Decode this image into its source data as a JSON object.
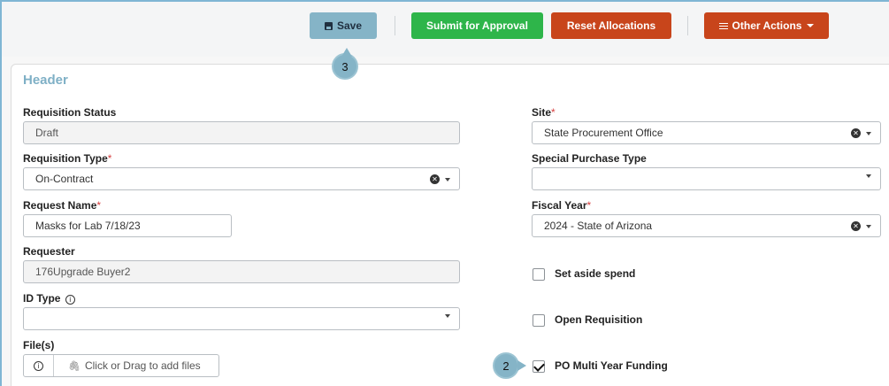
{
  "toolbar": {
    "save_label": "Save",
    "submit_label": "Submit for Approval",
    "reset_label": "Reset Allocations",
    "other_label": "Other Actions"
  },
  "callouts": {
    "step3": "3",
    "step2": "2"
  },
  "header": {
    "title": "Header"
  },
  "left": {
    "requisition_status": {
      "label": "Requisition Status",
      "value": "Draft"
    },
    "requisition_type": {
      "label": "Requisition Type",
      "required": "*",
      "value": "On-Contract"
    },
    "request_name": {
      "label": "Request Name",
      "required": "*",
      "value": "Masks for Lab 7/18/23"
    },
    "requester": {
      "label": "Requester",
      "value": "176Upgrade Buyer2"
    },
    "id_type": {
      "label": "ID Type",
      "value": ""
    },
    "files": {
      "label": "File(s)",
      "placeholder": "Click or Drag to add files"
    }
  },
  "right": {
    "site": {
      "label": "Site",
      "required": "*",
      "value": "State Procurement Office"
    },
    "special_purchase_type": {
      "label": "Special Purchase Type",
      "value": ""
    },
    "fiscal_year": {
      "label": "Fiscal Year",
      "required": "*",
      "value": "2024 - State of Arizona"
    },
    "set_aside_spend": {
      "label": "Set aside spend",
      "checked": false
    },
    "open_requisition": {
      "label": "Open Requisition",
      "checked": false
    },
    "po_multi_year_funding": {
      "label": "PO Multi Year Funding",
      "checked": true
    }
  },
  "colors": {
    "save": "#85b4c7",
    "submit": "#2eb54a",
    "reset": "#c8451b",
    "other": "#c8451b",
    "header_title": "#7fb0c6"
  }
}
